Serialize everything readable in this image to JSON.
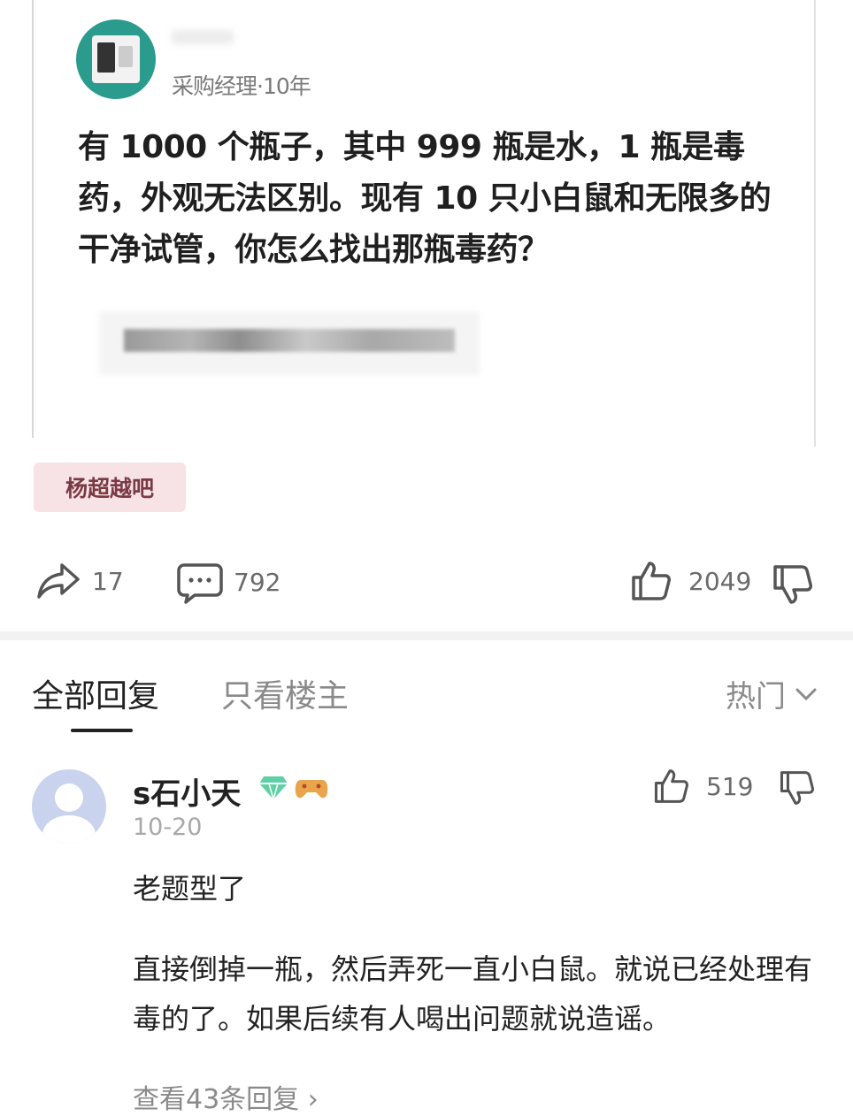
{
  "post": {
    "author_meta": "采购经理·10年",
    "body": "有 1000 个瓶子，其中 999 瓶是水，1 瓶是毒药，外观无法区别。现有 10 只小白鼠和无限多的干净试管，你怎么找出那瓶毒药？",
    "tag": "杨超越吧",
    "share_count": "17",
    "comment_count": "792",
    "like_count": "2049"
  },
  "tabs": {
    "all": "全部回复",
    "owner_only": "只看楼主",
    "sort": "热门"
  },
  "comment": {
    "name": "s石小天",
    "date": "10-20",
    "likes": "519",
    "text1": "老题型了",
    "text2": "直接倒掉一瓶，然后弄死一直小白鼠。就说已经处理有毒的了。如果后续有人喝出问题就说造谣。",
    "more": "查看43条回复 ›"
  },
  "colors": {
    "avatar_main": "#2a9b8c",
    "tag_bg": "#f7e3e6",
    "comment_avatar": "#c9d3ee"
  },
  "icons": [
    "share-icon",
    "comment-icon",
    "thumb-up-icon",
    "thumb-down-icon",
    "chevron-down-icon",
    "gem-badge-icon",
    "game-badge-icon"
  ]
}
